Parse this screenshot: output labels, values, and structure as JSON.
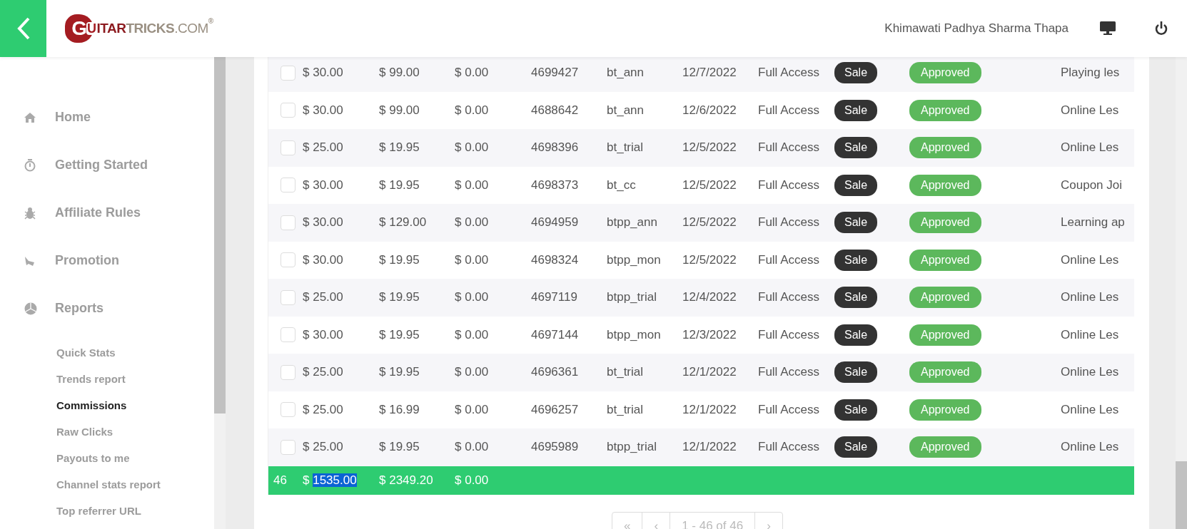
{
  "header": {
    "logo": [
      {
        "kind": "mark",
        "text": "G"
      },
      {
        "kind": "inner",
        "text": "U"
      },
      {
        "kind": "strong",
        "text": "ITAR"
      },
      {
        "kind": "light",
        "text": "TRICKS"
      },
      {
        "kind": "thin",
        "text": ".COM"
      },
      {
        "kind": "sup",
        "text": "®"
      }
    ],
    "user": "Khimawati Padhya Sharma Thapa"
  },
  "sidebar": {
    "items": [
      {
        "label": "Home"
      },
      {
        "label": "Getting Started"
      },
      {
        "label": "Affiliate Rules"
      },
      {
        "label": "Promotion"
      },
      {
        "label": "Reports"
      }
    ],
    "subitems": [
      {
        "label": "Quick Stats",
        "selected": false
      },
      {
        "label": "Trends report",
        "selected": false
      },
      {
        "label": "Commissions",
        "selected": true
      },
      {
        "label": "Raw Clicks",
        "selected": false
      },
      {
        "label": "Payouts to me",
        "selected": false
      },
      {
        "label": "Channel stats report",
        "selected": false
      },
      {
        "label": "Top referrer URL",
        "selected": false
      }
    ]
  },
  "table": {
    "rows": [
      {
        "checked": false,
        "commission": "$ 30.00",
        "amount": "$ 99.00",
        "column_3": "$ 0.00",
        "order": "4699427",
        "plan": "bt_ann",
        "date": "12/7/2022",
        "product": "Full Access",
        "type": "Sale",
        "status": "Approved",
        "description": "Playing les"
      },
      {
        "checked": false,
        "commission": "$ 30.00",
        "amount": "$ 99.00",
        "column_3": "$ 0.00",
        "order": "4688642",
        "plan": "bt_ann",
        "date": "12/6/2022",
        "product": "Full Access",
        "type": "Sale",
        "status": "Approved",
        "description": "Online Les"
      },
      {
        "checked": false,
        "commission": "$ 25.00",
        "amount": "$ 19.95",
        "column_3": "$ 0.00",
        "order": "4698396",
        "plan": "bt_trial",
        "date": "12/5/2022",
        "product": "Full Access",
        "type": "Sale",
        "status": "Approved",
        "description": "Online Les"
      },
      {
        "checked": false,
        "commission": "$ 30.00",
        "amount": "$ 19.95",
        "column_3": "$ 0.00",
        "order": "4698373",
        "plan": "bt_cc",
        "date": "12/5/2022",
        "product": "Full Access",
        "type": "Sale",
        "status": "Approved",
        "description": "Coupon Joi"
      },
      {
        "checked": false,
        "commission": "$ 30.00",
        "amount": "$ 129.00",
        "column_3": "$ 0.00",
        "order": "4694959",
        "plan": "btpp_ann",
        "date": "12/5/2022",
        "product": "Full Access",
        "type": "Sale",
        "status": "Approved",
        "description": "Learning ap"
      },
      {
        "checked": false,
        "commission": "$ 30.00",
        "amount": "$ 19.95",
        "column_3": "$ 0.00",
        "order": "4698324",
        "plan": "btpp_mon",
        "date": "12/5/2022",
        "product": "Full Access",
        "type": "Sale",
        "status": "Approved",
        "description": "Online Les"
      },
      {
        "checked": false,
        "commission": "$ 25.00",
        "amount": "$ 19.95",
        "column_3": "$ 0.00",
        "order": "4697119",
        "plan": "btpp_trial",
        "date": "12/4/2022",
        "product": "Full Access",
        "type": "Sale",
        "status": "Approved",
        "description": "Online Les"
      },
      {
        "checked": false,
        "commission": "$ 30.00",
        "amount": "$ 19.95",
        "column_3": "$ 0.00",
        "order": "4697144",
        "plan": "btpp_mon",
        "date": "12/3/2022",
        "product": "Full Access",
        "type": "Sale",
        "status": "Approved",
        "description": "Online Les"
      },
      {
        "checked": false,
        "commission": "$ 25.00",
        "amount": "$ 19.95",
        "column_3": "$ 0.00",
        "order": "4696361",
        "plan": "bt_trial",
        "date": "12/1/2022",
        "product": "Full Access",
        "type": "Sale",
        "status": "Approved",
        "description": "Online Les"
      },
      {
        "checked": false,
        "commission": "$ 25.00",
        "amount": "$ 16.99",
        "column_3": "$ 0.00",
        "order": "4696257",
        "plan": "bt_trial",
        "date": "12/1/2022",
        "product": "Full Access",
        "type": "Sale",
        "status": "Approved",
        "description": "Online Les"
      },
      {
        "checked": false,
        "commission": "$ 25.00",
        "amount": "$ 19.95",
        "column_3": "$ 0.00",
        "order": "4695989",
        "plan": "btpp_trial",
        "date": "12/1/2022",
        "product": "Full Access",
        "type": "Sale",
        "status": "Approved",
        "description": "Online Les"
      }
    ],
    "total": {
      "count": "46",
      "cells": [
        [
          {
            "text": "$ ",
            "selected": false
          },
          {
            "text": "1535.00",
            "selected": true
          }
        ],
        [
          {
            "text": "$ 2349.20",
            "selected": false
          }
        ],
        [
          {
            "text": "$ 0.00",
            "selected": false
          }
        ]
      ]
    }
  },
  "pagination": [
    "«",
    "‹",
    "1 - 46 of 46",
    "›"
  ]
}
